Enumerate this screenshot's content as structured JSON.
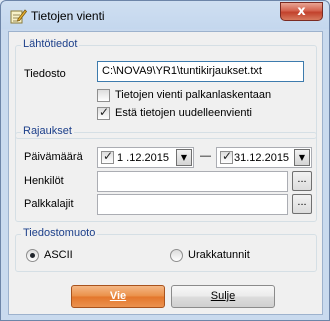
{
  "window": {
    "title": "Tietojen vienti",
    "close_label": "x"
  },
  "source": {
    "legend": "Lähtötiedot",
    "file_label": "Tiedosto",
    "file_value": "C:\\NOVA9\\YR1\\tuntikirjaukset.txt",
    "options": [
      {
        "label": "Tietojen vienti palkanlaskentaan",
        "checked": false
      },
      {
        "label": "Estä tietojen uudelleenvienti",
        "checked": true
      }
    ]
  },
  "filters": {
    "legend": "Rajaukset",
    "date_label": "Päivämäärä",
    "date_from": "1 .12.2015",
    "date_to": "31.12.2015",
    "range_separator": "—",
    "persons_label": "Henkilöt",
    "persons_value": "",
    "paytypes_label": "Palkkalajit",
    "paytypes_value": "",
    "browse_label": "..."
  },
  "format": {
    "legend": "Tiedostomuoto",
    "options": [
      {
        "label": "ASCII",
        "selected": true
      },
      {
        "label": "Urakkatunnit",
        "selected": false
      }
    ]
  },
  "actions": {
    "export_label": "Vie",
    "close_label": "Sulje"
  },
  "colors": {
    "legend_text": "#1c3f8a",
    "primary_button": "#e3762b",
    "close_button": "#c2412c"
  },
  "icons": {
    "app": "notepad-pencil-icon",
    "checkmark": "check-icon",
    "dropdown": "chevron-down-icon"
  }
}
